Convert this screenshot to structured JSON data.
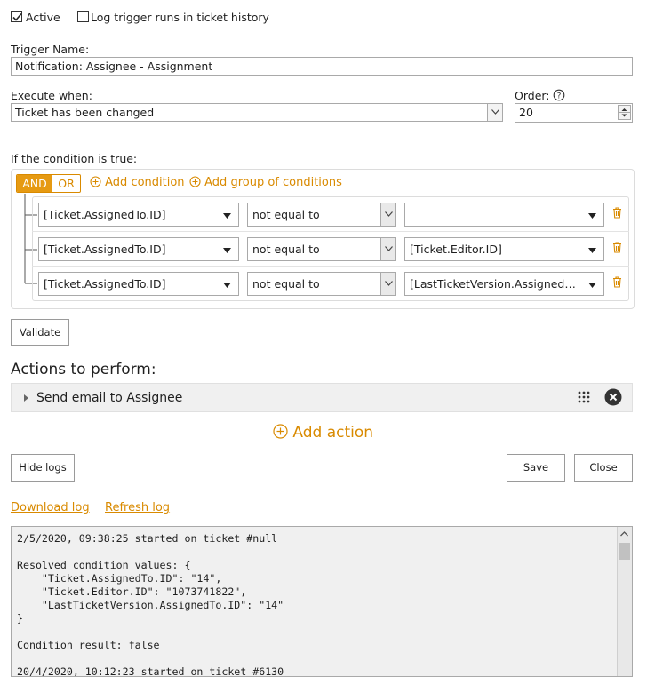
{
  "top": {
    "active_label": "Active",
    "active_checked": true,
    "log_label": "Log trigger runs in ticket history",
    "log_checked": false
  },
  "trigger_name": {
    "label": "Trigger Name:",
    "value": "Notification: Assignee - Assignment"
  },
  "execute_when": {
    "label": "Execute when:",
    "value": "Ticket has been changed"
  },
  "order": {
    "label": "Order:",
    "value": "20"
  },
  "conditions": {
    "label": "If the condition is true:",
    "and_label": "AND",
    "or_label": "OR",
    "add_condition": "Add condition",
    "add_group": "Add group of conditions",
    "rows": [
      {
        "field": "[Ticket.AssignedTo.ID]",
        "operator": "not equal to",
        "value": ""
      },
      {
        "field": "[Ticket.AssignedTo.ID]",
        "operator": "not equal to",
        "value": "[Ticket.Editor.ID]"
      },
      {
        "field": "[Ticket.AssignedTo.ID]",
        "operator": "not equal to",
        "value": "[LastTicketVersion.Assigned…"
      }
    ]
  },
  "validate_label": "Validate",
  "actions": {
    "heading": "Actions to perform:",
    "items": [
      {
        "label": "Send email to Assignee"
      }
    ],
    "add_action": "Add action"
  },
  "footer": {
    "hide_logs": "Hide logs",
    "save": "Save",
    "close": "Close"
  },
  "log_links": {
    "download": "Download log",
    "refresh": "Refresh log"
  },
  "log_text": "2/5/2020, 09:38:25 started on ticket #null\n\nResolved condition values: {\n    \"Ticket.AssignedTo.ID\": \"14\",\n    \"Ticket.Editor.ID\": \"1073741822\",\n    \"LastTicketVersion.AssignedTo.ID\": \"14\"\n}\n\nCondition result: false\n\n20/4/2020, 10:12:23 started on ticket #6130",
  "colors": {
    "accent": "#d98a00",
    "trash": "#d98a00",
    "border": "#a9a9a9"
  },
  "icons": [
    "checkbox-checked-icon",
    "checkbox-empty-icon",
    "help-icon",
    "plus-circle-icon",
    "trash-icon",
    "caret-right-icon",
    "drag-grid-icon",
    "close-circle-icon"
  ]
}
